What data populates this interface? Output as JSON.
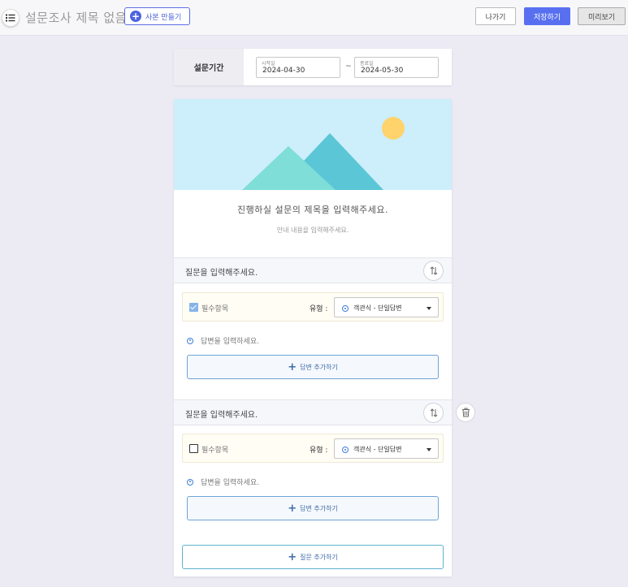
{
  "header": {
    "doc_title": "설문조사 제목 없음",
    "copy_label": "사본 만들기",
    "exit_label": "나가기",
    "save_label": "저장하기",
    "preview_label": "미리보기"
  },
  "period": {
    "label": "설문기간",
    "start_label": "시작일",
    "start_value": "2024-04-30",
    "separator": "~",
    "end_label": "종료일",
    "end_value": "2024-05-30"
  },
  "survey": {
    "title_placeholder": "진행하실 설문의 제목을 입력해주세요.",
    "desc_placeholder": "안내 내용을 입력해주세요."
  },
  "questions": [
    {
      "text": "질문을 입력해주세요.",
      "required_label": "필수항목",
      "required": true,
      "type_label": "유형 :",
      "type_value": "객관식 - 단일답변",
      "answer_placeholder": "답변을 입력하세요.",
      "add_answer_label": "답변 추가하기"
    },
    {
      "text": "질문을 입력해주세요.",
      "required_label": "필수항목",
      "required": false,
      "type_label": "유형 :",
      "type_value": "객관식 - 단일답변",
      "answer_placeholder": "답변을 입력하세요.",
      "add_answer_label": "답변 추가하기"
    }
  ],
  "add_question_label": "질문 추가하기",
  "icons": {
    "menu": "list-icon",
    "copy": "plus-circle-icon",
    "sort": "sort-arrows-icon",
    "trash": "trash-icon",
    "plus": "plus-icon"
  },
  "colors": {
    "primary": "#5870f0",
    "banner_sky": "#cdeefb",
    "sun": "#ffd36b",
    "mountain_back": "#5bc6d6",
    "mountain_front": "#7fded8"
  }
}
